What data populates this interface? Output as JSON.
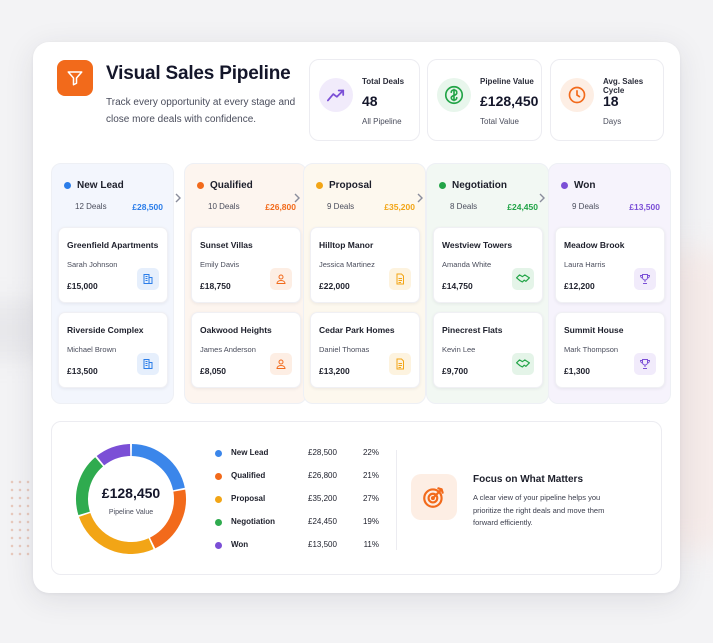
{
  "header": {
    "title": "Visual Sales Pipeline",
    "subtitle": "Track every opportunity at every stage and close more deals with confidence.",
    "logo_icon": "funnel-icon"
  },
  "kpis": [
    {
      "label": "Total Deals",
      "value": "48",
      "sub": "All Pipeline",
      "icon": "trend-line-icon",
      "color": "#7b4fd6",
      "bg": "#f1ebfb"
    },
    {
      "label": "Pipeline Value",
      "value": "£128,450",
      "sub": "Total Value",
      "icon": "pound-circle-icon",
      "color": "#22a447",
      "bg": "#e8f6ec"
    },
    {
      "label": "Avg. Sales Cycle",
      "value": "18",
      "sub": "Days",
      "icon": "clock-icon",
      "color": "#f26a1b",
      "bg": "#fdeee4"
    }
  ],
  "stages": [
    {
      "name": "New Lead",
      "count": "12 Deals",
      "amount": "£28,500",
      "color": "#2b7de9",
      "bg": "#f3f6fd",
      "deals": [
        {
          "name": "Greenfield Apartments",
          "person": "Sarah Johnson",
          "value": "£15,000",
          "icon": "building-icon",
          "icon_bg": "#e6effc"
        },
        {
          "name": "Riverside Complex",
          "person": "Michael Brown",
          "value": "£13,500",
          "icon": "building-icon",
          "icon_bg": "#e6effc"
        }
      ]
    },
    {
      "name": "Qualified",
      "count": "10 Deals",
      "amount": "£26,800",
      "color": "#f26a1b",
      "bg": "#fdf5ef",
      "deals": [
        {
          "name": "Sunset Villas",
          "person": "Emily Davis",
          "value": "£18,750",
          "icon": "person-icon",
          "icon_bg": "#fdeee4"
        },
        {
          "name": "Oakwood Heights",
          "person": "James Anderson",
          "value": "£8,050",
          "icon": "person-icon",
          "icon_bg": "#fdeee4"
        }
      ]
    },
    {
      "name": "Proposal",
      "count": "9 Deals",
      "amount": "£35,200",
      "color": "#f2a516",
      "bg": "#fdf8ee",
      "deals": [
        {
          "name": "Hilltop Manor",
          "person": "Jessica Martinez",
          "value": "£22,000",
          "icon": "document-icon",
          "icon_bg": "#fdf3df"
        },
        {
          "name": "Cedar Park Homes",
          "person": "Daniel Thomas",
          "value": "£13,200",
          "icon": "document-icon",
          "icon_bg": "#fdf3df"
        }
      ]
    },
    {
      "name": "Negotiation",
      "count": "8 Deals",
      "amount": "£24,450",
      "color": "#22a447",
      "bg": "#f2f8f3",
      "deals": [
        {
          "name": "Westview Towers",
          "person": "Amanda White",
          "value": "£14,750",
          "icon": "handshake-icon",
          "icon_bg": "#e4f4e8"
        },
        {
          "name": "Pinecrest Flats",
          "person": "Kevin Lee",
          "value": "£9,700",
          "icon": "handshake-icon",
          "icon_bg": "#e4f4e8"
        }
      ]
    },
    {
      "name": "Won",
      "count": "9 Deals",
      "amount": "£13,500",
      "color": "#7b4fd6",
      "bg": "#f6f3fc",
      "deals": [
        {
          "name": "Meadow Brook",
          "person": "Laura Harris",
          "value": "£12,200",
          "icon": "trophy-icon",
          "icon_bg": "#f1ebfb"
        },
        {
          "name": "Summit House",
          "person": "Mark Thompson",
          "value": "£1,300",
          "icon": "trophy-icon",
          "icon_bg": "#f1ebfb"
        }
      ]
    }
  ],
  "summary": {
    "total": "£128,450",
    "total_label": "Pipeline Value",
    "legend": [
      {
        "name": "New Lead",
        "value": "£28,500",
        "pct": "22%",
        "share": 22,
        "color": "#3b86ea"
      },
      {
        "name": "Qualified",
        "value": "£26,800",
        "pct": "21%",
        "share": 21,
        "color": "#f26a1b"
      },
      {
        "name": "Proposal",
        "value": "£35,200",
        "pct": "27%",
        "share": 27,
        "color": "#f2a516"
      },
      {
        "name": "Negotiation",
        "value": "£24,450",
        "pct": "19%",
        "share": 19,
        "color": "#2fab4f"
      },
      {
        "name": "Won",
        "value": "£13,500",
        "pct": "11%",
        "share": 11,
        "color": "#7b4fd6"
      }
    ],
    "focus_title": "Focus on What Matters",
    "focus_text": "A clear view of your pipeline helps you prioritize the right deals and move them forward efficiently.",
    "focus_icon": "target-arrow-icon"
  }
}
